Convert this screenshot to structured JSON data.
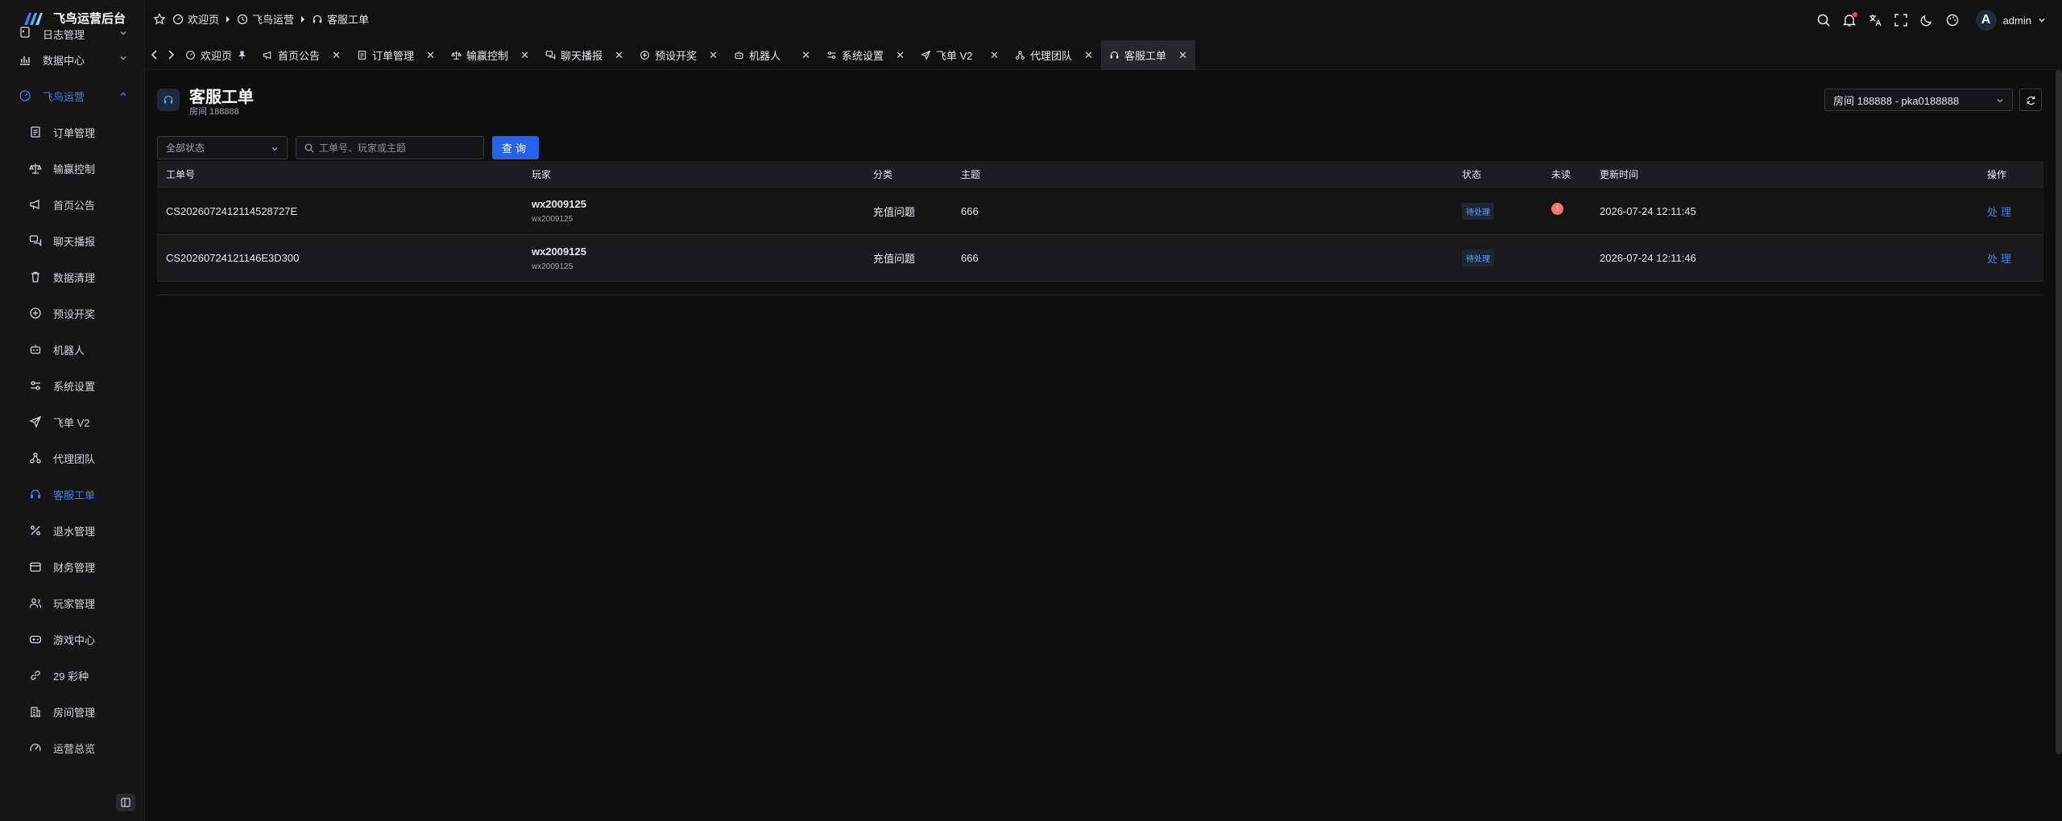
{
  "app": {
    "logo_text": "飞鸟运营后台"
  },
  "sidebar": {
    "items": [
      {
        "label": "日志管理",
        "icon": "log-icon",
        "group": true,
        "partial": true
      },
      {
        "label": "数据中心",
        "icon": "chart-icon",
        "group": true
      },
      {
        "label": "飞鸟运营",
        "icon": "gauge-icon",
        "group": true,
        "open": true
      },
      {
        "label": "订单管理",
        "icon": "doc-icon"
      },
      {
        "label": "输赢控制",
        "icon": "scale-icon"
      },
      {
        "label": "首页公告",
        "icon": "megaphone-icon"
      },
      {
        "label": "聊天播报",
        "icon": "chat-icon"
      },
      {
        "label": "数据清理",
        "icon": "trash-icon"
      },
      {
        "label": "预设开奖",
        "icon": "plus-circle-icon"
      },
      {
        "label": "机器人",
        "icon": "robot-icon"
      },
      {
        "label": "系统设置",
        "icon": "sliders-icon"
      },
      {
        "label": "飞单 V2",
        "icon": "send-icon"
      },
      {
        "label": "代理团队",
        "icon": "team-icon"
      },
      {
        "label": "客服工单",
        "icon": "headset-icon",
        "active": true
      },
      {
        "label": "退水管理",
        "icon": "percent-icon"
      },
      {
        "label": "财务管理",
        "icon": "wallet-icon"
      },
      {
        "label": "玩家管理",
        "icon": "users-icon"
      },
      {
        "label": "游戏中心",
        "icon": "gamepad-icon"
      },
      {
        "label": "29 彩种",
        "icon": "link-icon"
      },
      {
        "label": "房间管理",
        "icon": "building-icon"
      },
      {
        "label": "运营总览",
        "icon": "speedometer-icon"
      }
    ]
  },
  "breadcrumb": [
    "欢迎页",
    "飞鸟运营",
    "客服工单"
  ],
  "header": {
    "username": "admin",
    "avatar_letter": "A"
  },
  "tabs": [
    {
      "label": "欢迎页",
      "icon": "gauge-icon",
      "pinned": true
    },
    {
      "label": "首页公告",
      "icon": "megaphone-icon"
    },
    {
      "label": "订单管理",
      "icon": "doc-icon"
    },
    {
      "label": "输赢控制",
      "icon": "scale-icon"
    },
    {
      "label": "聊天播报",
      "icon": "chat-icon"
    },
    {
      "label": "预设开奖",
      "icon": "plus-circle-icon"
    },
    {
      "label": "机器人",
      "icon": "robot-icon"
    },
    {
      "label": "系统设置",
      "icon": "sliders-icon"
    },
    {
      "label": "飞单 V2",
      "icon": "send-icon"
    },
    {
      "label": "代理团队",
      "icon": "team-icon"
    },
    {
      "label": "客服工单",
      "icon": "headset-icon",
      "active": true
    }
  ],
  "page": {
    "title": "客服工单",
    "subtitle": "房间 188888",
    "room_select": "房间 188888 - pka0188888",
    "status_filter": "全部状态",
    "search_placeholder": "工单号、玩家或主题",
    "query_label": "查询"
  },
  "table": {
    "headers": {
      "id": "工单号",
      "player": "玩家",
      "category": "分类",
      "subject": "主题",
      "status": "状态",
      "unread": "未读",
      "updated": "更新时间",
      "action": "操作"
    },
    "rows": [
      {
        "id": "CS20260724121145287 27E",
        "player": "wx2009125",
        "player_sub": "wx2009125",
        "category": "充值问题",
        "subject": "666",
        "status": "待处理",
        "unread": "1",
        "updated": "2026-07-24 12:11:45",
        "action": "处理"
      },
      {
        "id": "CS20260724121146E3D300",
        "player": "wx2009125",
        "player_sub": "wx2009125",
        "category": "充值问题",
        "subject": "666",
        "status": "待处理",
        "unread": "",
        "updated": "2026-07-24 12:11:46",
        "action": "处理"
      }
    ]
  },
  "colors": {
    "accent": "#3b82f6",
    "background": "#0f0f10",
    "unread": "#f87171"
  }
}
